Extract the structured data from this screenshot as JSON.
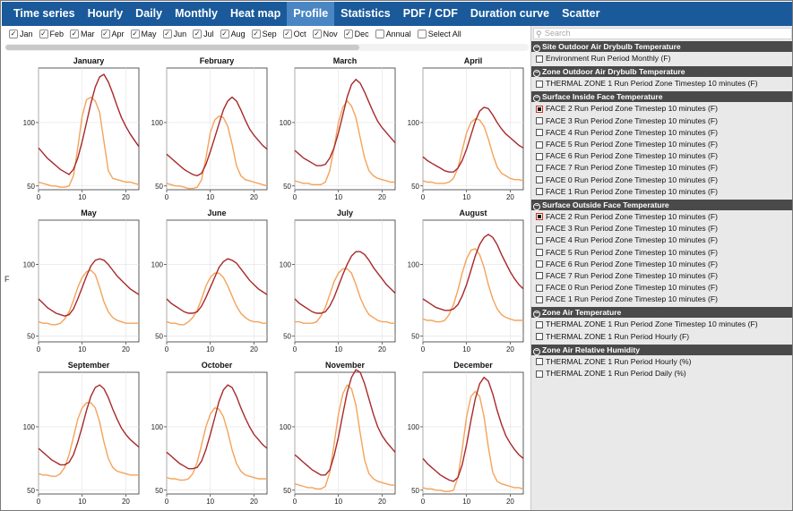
{
  "tabs": [
    "Time series",
    "Hourly",
    "Daily",
    "Monthly",
    "Heat map",
    "Profile",
    "Statistics",
    "PDF / CDF",
    "Duration curve",
    "Scatter"
  ],
  "active_tab": "Profile",
  "month_filters": [
    {
      "label": "Jan",
      "checked": true
    },
    {
      "label": "Feb",
      "checked": true
    },
    {
      "label": "Mar",
      "checked": true
    },
    {
      "label": "Apr",
      "checked": true
    },
    {
      "label": "May",
      "checked": true
    },
    {
      "label": "Jun",
      "checked": true
    },
    {
      "label": "Jul",
      "checked": true
    },
    {
      "label": "Aug",
      "checked": true
    },
    {
      "label": "Sep",
      "checked": true
    },
    {
      "label": "Oct",
      "checked": true
    },
    {
      "label": "Nov",
      "checked": true
    },
    {
      "label": "Dec",
      "checked": true
    },
    {
      "label": "Annual",
      "checked": false
    },
    {
      "label": "Select All",
      "checked": false
    }
  ],
  "search": {
    "placeholder": "Search"
  },
  "colors": {
    "series_dark": "#a8292b",
    "series_light": "#f4a35a",
    "tabbar": "#1a5a9a",
    "tab_active": "#4a86c4"
  },
  "variable_groups": [
    {
      "title": "Site Outdoor Air Drybulb Temperature",
      "items": [
        {
          "label": "Environment Run Period Monthly (F)",
          "checked": false
        }
      ]
    },
    {
      "title": "Zone Outdoor Air Drybulb Temperature",
      "items": [
        {
          "label": "THERMAL ZONE 1 Run Period Zone Timestep 10 minutes (F)",
          "checked": false
        }
      ]
    },
    {
      "title": "Surface Inside Face Temperature",
      "items": [
        {
          "label": "FACE 2 Run Period Zone Timestep 10 minutes (F)",
          "checked": true
        },
        {
          "label": "FACE 3 Run Period Zone Timestep 10 minutes (F)",
          "checked": false
        },
        {
          "label": "FACE 4 Run Period Zone Timestep 10 minutes (F)",
          "checked": false
        },
        {
          "label": "FACE 5 Run Period Zone Timestep 10 minutes (F)",
          "checked": false
        },
        {
          "label": "FACE 6 Run Period Zone Timestep 10 minutes (F)",
          "checked": false
        },
        {
          "label": "FACE 7 Run Period Zone Timestep 10 minutes (F)",
          "checked": false
        },
        {
          "label": "FACE 0 Run Period Zone Timestep 10 minutes (F)",
          "checked": false
        },
        {
          "label": "FACE 1 Run Period Zone Timestep 10 minutes (F)",
          "checked": false
        }
      ]
    },
    {
      "title": "Surface Outside Face Temperature",
      "items": [
        {
          "label": "FACE 2 Run Period Zone Timestep 10 minutes (F)",
          "checked": true
        },
        {
          "label": "FACE 3 Run Period Zone Timestep 10 minutes (F)",
          "checked": false
        },
        {
          "label": "FACE 4 Run Period Zone Timestep 10 minutes (F)",
          "checked": false
        },
        {
          "label": "FACE 5 Run Period Zone Timestep 10 minutes (F)",
          "checked": false
        },
        {
          "label": "FACE 6 Run Period Zone Timestep 10 minutes (F)",
          "checked": false
        },
        {
          "label": "FACE 7 Run Period Zone Timestep 10 minutes (F)",
          "checked": false
        },
        {
          "label": "FACE 0 Run Period Zone Timestep 10 minutes (F)",
          "checked": false
        },
        {
          "label": "FACE 1 Run Period Zone Timestep 10 minutes (F)",
          "checked": false
        }
      ]
    },
    {
      "title": "Zone Air Temperature",
      "items": [
        {
          "label": "THERMAL ZONE 1 Run Period Zone Timestep 10 minutes (F)",
          "checked": false
        },
        {
          "label": "THERMAL ZONE 1 Run Period Hourly (F)",
          "checked": false
        }
      ]
    },
    {
      "title": "Zone Air Relative Humidity",
      "items": [
        {
          "label": "THERMAL ZONE 1 Run Period Hourly (%)",
          "checked": false
        },
        {
          "label": "THERMAL ZONE 1 Run Period Daily (%)",
          "checked": false
        }
      ]
    }
  ],
  "chart_data": {
    "type": "line",
    "ylabel": "F",
    "x_ticks": [
      0,
      10,
      20
    ],
    "xlim": [
      0,
      23
    ],
    "hours": [
      0,
      1,
      2,
      3,
      4,
      5,
      6,
      7,
      8,
      9,
      10,
      11,
      12,
      13,
      14,
      15,
      16,
      17,
      18,
      19,
      20,
      21,
      22,
      23
    ],
    "panels": [
      {
        "title": "January",
        "ylim": [
          47,
          143
        ],
        "y_ticks": [
          50,
          100
        ],
        "dark": [
          80,
          76,
          72,
          69,
          66,
          63,
          61,
          59,
          63,
          72,
          85,
          100,
          115,
          128,
          136,
          138,
          132,
          123,
          113,
          104,
          97,
          91,
          86,
          81
        ],
        "light": [
          53,
          52,
          51,
          50,
          50,
          49,
          49,
          50,
          58,
          80,
          105,
          118,
          120,
          117,
          108,
          85,
          62,
          56,
          55,
          54,
          53,
          53,
          52,
          51
        ]
      },
      {
        "title": "February",
        "ylim": [
          47,
          143
        ],
        "y_ticks": [
          50,
          100
        ],
        "dark": [
          75,
          72,
          69,
          66,
          63,
          61,
          59,
          58,
          60,
          67,
          77,
          88,
          99,
          110,
          117,
          120,
          117,
          110,
          102,
          95,
          90,
          86,
          82,
          79
        ],
        "light": [
          52,
          51,
          50,
          50,
          49,
          48,
          48,
          49,
          55,
          72,
          92,
          102,
          105,
          104,
          97,
          83,
          66,
          58,
          55,
          54,
          53,
          52,
          51,
          50
        ],
        "dark_tail_label": ""
      },
      {
        "title": "March",
        "ylim": [
          47,
          143
        ],
        "y_ticks": [
          50,
          100
        ],
        "dark": [
          78,
          75,
          72,
          70,
          68,
          66,
          66,
          67,
          72,
          80,
          92,
          106,
          120,
          130,
          134,
          131,
          124,
          116,
          108,
          101,
          96,
          92,
          88,
          84
        ],
        "light": [
          54,
          53,
          52,
          52,
          51,
          51,
          51,
          53,
          62,
          80,
          100,
          112,
          117,
          113,
          104,
          88,
          72,
          62,
          58,
          56,
          55,
          54,
          53,
          53
        ]
      },
      {
        "title": "April",
        "ylim": [
          47,
          143
        ],
        "y_ticks": [
          50,
          100
        ],
        "dark": [
          73,
          70,
          68,
          66,
          64,
          62,
          61,
          61,
          64,
          70,
          79,
          90,
          101,
          109,
          112,
          111,
          106,
          100,
          95,
          91,
          88,
          85,
          82,
          80
        ],
        "light": [
          54,
          53,
          53,
          52,
          52,
          52,
          53,
          56,
          64,
          78,
          92,
          100,
          103,
          102,
          97,
          87,
          75,
          65,
          60,
          58,
          56,
          55,
          55,
          54
        ]
      },
      {
        "title": "May",
        "ylim": [
          46,
          131
        ],
        "y_ticks": [
          50,
          100
        ],
        "dark": [
          76,
          73,
          70,
          68,
          66,
          65,
          64,
          65,
          69,
          76,
          84,
          92,
          99,
          103,
          104,
          103,
          100,
          96,
          92,
          89,
          86,
          83,
          81,
          79
        ],
        "light": [
          60,
          59,
          59,
          58,
          58,
          59,
          62,
          67,
          75,
          84,
          91,
          95,
          96,
          93,
          84,
          74,
          67,
          63,
          61,
          60,
          59,
          59,
          59,
          59
        ]
      },
      {
        "title": "June",
        "ylim": [
          46,
          131
        ],
        "y_ticks": [
          50,
          100
        ],
        "dark": [
          76,
          73,
          71,
          69,
          67,
          66,
          66,
          67,
          71,
          77,
          84,
          91,
          98,
          102,
          104,
          103,
          101,
          97,
          93,
          89,
          86,
          83,
          81,
          79
        ],
        "light": [
          60,
          59,
          59,
          58,
          58,
          60,
          63,
          68,
          76,
          85,
          91,
          94,
          94,
          91,
          85,
          78,
          71,
          66,
          63,
          61,
          60,
          60,
          59,
          59
        ]
      },
      {
        "title": "July",
        "ylim": [
          46,
          131
        ],
        "y_ticks": [
          50,
          100
        ],
        "dark": [
          76,
          73,
          71,
          69,
          67,
          66,
          66,
          67,
          71,
          77,
          85,
          93,
          100,
          106,
          109,
          109,
          107,
          103,
          98,
          94,
          90,
          86,
          83,
          80
        ],
        "light": [
          60,
          60,
          59,
          59,
          59,
          60,
          64,
          70,
          79,
          88,
          94,
          97,
          97,
          94,
          86,
          77,
          70,
          65,
          63,
          61,
          60,
          60,
          59,
          59
        ]
      },
      {
        "title": "August",
        "ylim": [
          46,
          131
        ],
        "y_ticks": [
          50,
          100
        ],
        "dark": [
          76,
          74,
          72,
          70,
          69,
          68,
          68,
          69,
          72,
          78,
          86,
          96,
          106,
          114,
          119,
          121,
          119,
          114,
          107,
          101,
          95,
          90,
          86,
          83
        ],
        "light": [
          62,
          61,
          61,
          60,
          60,
          61,
          65,
          72,
          82,
          94,
          104,
          110,
          111,
          107,
          98,
          86,
          76,
          69,
          65,
          63,
          62,
          61,
          61,
          61
        ]
      },
      {
        "title": "September",
        "ylim": [
          47,
          143
        ],
        "y_ticks": [
          50,
          100
        ],
        "dark": [
          83,
          80,
          77,
          74,
          72,
          70,
          70,
          72,
          78,
          88,
          100,
          113,
          124,
          131,
          133,
          130,
          123,
          114,
          106,
          99,
          94,
          90,
          87,
          84
        ],
        "light": [
          63,
          62,
          62,
          61,
          61,
          63,
          68,
          78,
          92,
          106,
          115,
          119,
          119,
          115,
          104,
          88,
          75,
          68,
          65,
          64,
          63,
          62,
          62,
          62
        ]
      },
      {
        "title": "October",
        "ylim": [
          47,
          143
        ],
        "y_ticks": [
          50,
          100
        ],
        "dark": [
          80,
          77,
          74,
          71,
          69,
          67,
          67,
          68,
          73,
          82,
          94,
          107,
          120,
          129,
          133,
          131,
          124,
          115,
          107,
          100,
          94,
          90,
          86,
          83
        ],
        "light": [
          60,
          59,
          59,
          58,
          58,
          59,
          63,
          72,
          86,
          100,
          110,
          115,
          114,
          108,
          96,
          82,
          71,
          65,
          62,
          61,
          60,
          59,
          59,
          59
        ]
      },
      {
        "title": "November",
        "ylim": [
          47,
          143
        ],
        "y_ticks": [
          50,
          100
        ],
        "dark": [
          78,
          75,
          72,
          69,
          66,
          64,
          62,
          62,
          66,
          77,
          92,
          110,
          127,
          139,
          145,
          143,
          134,
          122,
          110,
          100,
          93,
          88,
          84,
          80
        ],
        "light": [
          55,
          54,
          53,
          52,
          52,
          51,
          51,
          53,
          64,
          86,
          110,
          126,
          133,
          130,
          117,
          95,
          74,
          63,
          59,
          57,
          56,
          55,
          54,
          54
        ]
      },
      {
        "title": "December",
        "ylim": [
          47,
          143
        ],
        "y_ticks": [
          50,
          100
        ],
        "dark": [
          75,
          71,
          68,
          65,
          62,
          60,
          58,
          57,
          60,
          70,
          86,
          105,
          122,
          134,
          139,
          136,
          126,
          113,
          102,
          93,
          87,
          82,
          78,
          75
        ],
        "light": [
          52,
          51,
          51,
          50,
          50,
          49,
          49,
          50,
          60,
          82,
          108,
          124,
          128,
          124,
          108,
          84,
          64,
          57,
          55,
          54,
          53,
          52,
          52,
          51
        ]
      }
    ]
  }
}
